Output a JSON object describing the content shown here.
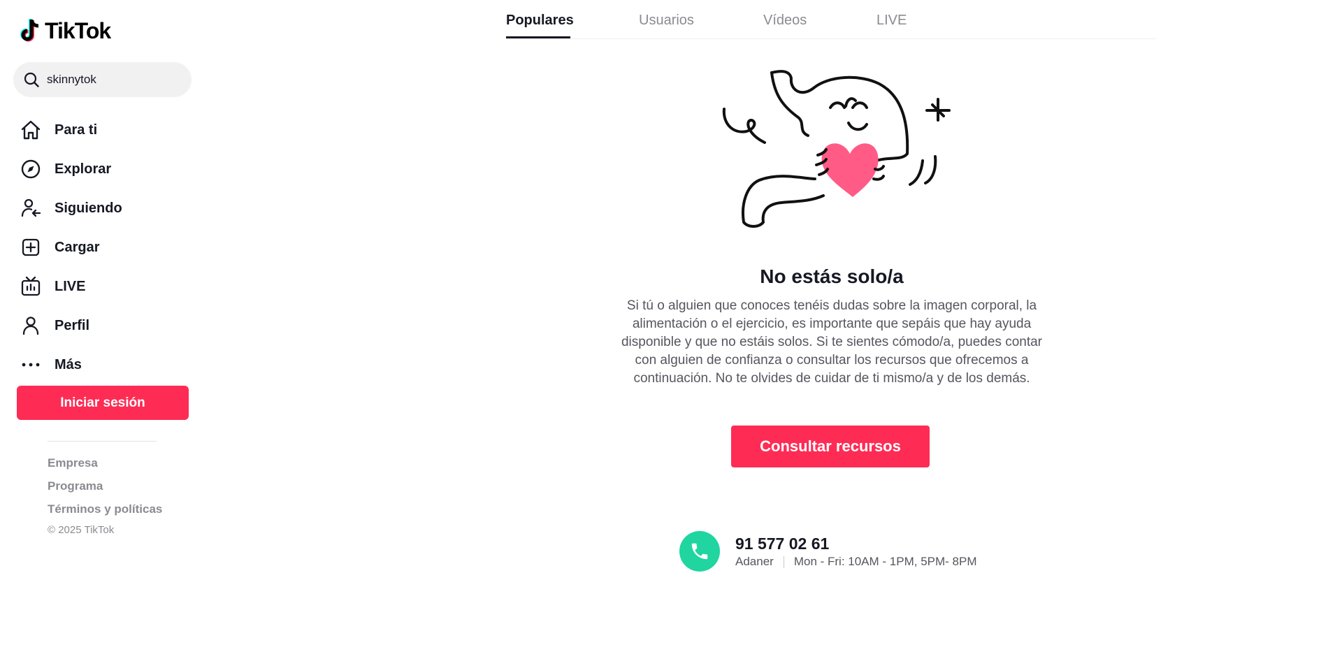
{
  "app": {
    "name": "TikTok"
  },
  "search": {
    "value": "skinnytok"
  },
  "sidebar": {
    "items": [
      {
        "label": "Para ti",
        "icon": "home-icon"
      },
      {
        "label": "Explorar",
        "icon": "compass-icon"
      },
      {
        "label": "Siguiendo",
        "icon": "following-icon"
      },
      {
        "label": "Cargar",
        "icon": "upload-icon"
      },
      {
        "label": "LIVE",
        "icon": "live-tv-icon"
      },
      {
        "label": "Perfil",
        "icon": "profile-icon"
      },
      {
        "label": "Más",
        "icon": "more-dots-icon"
      }
    ],
    "login_label": "Iniciar sesión",
    "footer_links": [
      "Empresa",
      "Programa",
      "Términos y políticas"
    ],
    "copyright": "© 2025 TikTok"
  },
  "tabs": [
    {
      "label": "Populares",
      "active": true
    },
    {
      "label": "Usuarios",
      "active": false
    },
    {
      "label": "Vídeos",
      "active": false
    },
    {
      "label": "LIVE",
      "active": false
    }
  ],
  "main": {
    "title": "No estás solo/a",
    "description": "Si tú o alguien que conoces tenéis dudas sobre la imagen corporal, la alimentación o el ejercicio, es importante que sepáis que hay ayuda disponible y que no estáis solos. Si te sientes cómodo/a, puedes contar con alguien de confianza o consultar los recursos que ofrecemos a continuación. No te olvides de cuidar de ti mismo/a y de los demás.",
    "cta_label": "Consultar recursos",
    "helpline": {
      "number": "91 577 02 61",
      "org": "Adaner",
      "hours": "Mon - Fri: 10AM - 1PM, 5PM- 8PM"
    }
  },
  "colors": {
    "brand_red": "#fe2c55",
    "helpline_green": "#20d5a0",
    "text_primary": "#161823",
    "text_muted": "#8a8b91"
  }
}
